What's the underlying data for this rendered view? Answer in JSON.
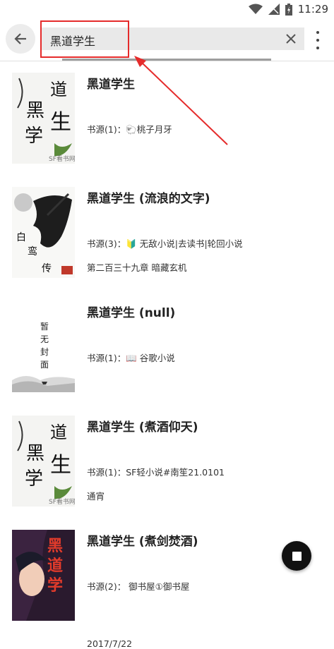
{
  "status_bar": {
    "time": "11:29"
  },
  "toolbar": {
    "search_value": "黑道学生"
  },
  "results": [
    {
      "title": "黑道学生",
      "source": "书源(1)：🐑桃子月牙",
      "latest": "",
      "cover": "ink-calligraphy"
    },
    {
      "title": "黑道学生 (流浪的文字)",
      "source": "书源(3)：🔰 无敌小说|去读书|轮回小说",
      "latest": "第二百三十九章 暗藏玄机",
      "cover": "horse-ink"
    },
    {
      "title": "黑道学生 (null)",
      "source": "书源(1)：📖 谷歌小说",
      "latest": "",
      "cover": "no-cover",
      "no_cover_text": "暂无封面"
    },
    {
      "title": "黑道学生 (煮酒仰天)",
      "source": "书源(1)：SF轻小说#南笙21.0101",
      "latest": "通宵",
      "cover": "ink-calligraphy"
    },
    {
      "title": "黑道学生 (煮剑焚酒)",
      "source": "书源(2)： 御书屋①御书屋",
      "latest": "2017/7/22",
      "cover": "anime-red"
    }
  ],
  "cover_text": {
    "ink": [
      "黑",
      "道",
      "学",
      "生"
    ],
    "horse": [
      "白",
      "鸾",
      "传"
    ],
    "anime": "黑道学",
    "watermark": "SF看书网"
  },
  "colors": {
    "annotation": "#e52b2b",
    "accent": "#111111"
  }
}
